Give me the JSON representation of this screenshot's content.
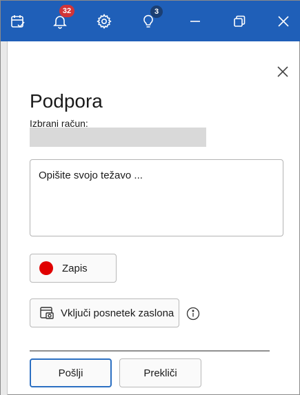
{
  "titlebar": {
    "accent": "#1f5fb8",
    "notifications_count": "32",
    "tips_count": "3",
    "buttons": [
      "calendar-check-icon",
      "bell-icon",
      "gear-icon",
      "lightbulb-icon",
      "minimize-icon",
      "restore-icon",
      "close-icon"
    ]
  },
  "panel": {
    "title": "Podpora",
    "account_label": "Izbrani račun:",
    "account_value": "",
    "description_placeholder": "Opišite svojo težavo ...",
    "record_label": "Zapis",
    "screenshot_label": "Vključi posnetek zaslona",
    "send_label": "Pošlji",
    "cancel_label": "Prekliči"
  }
}
